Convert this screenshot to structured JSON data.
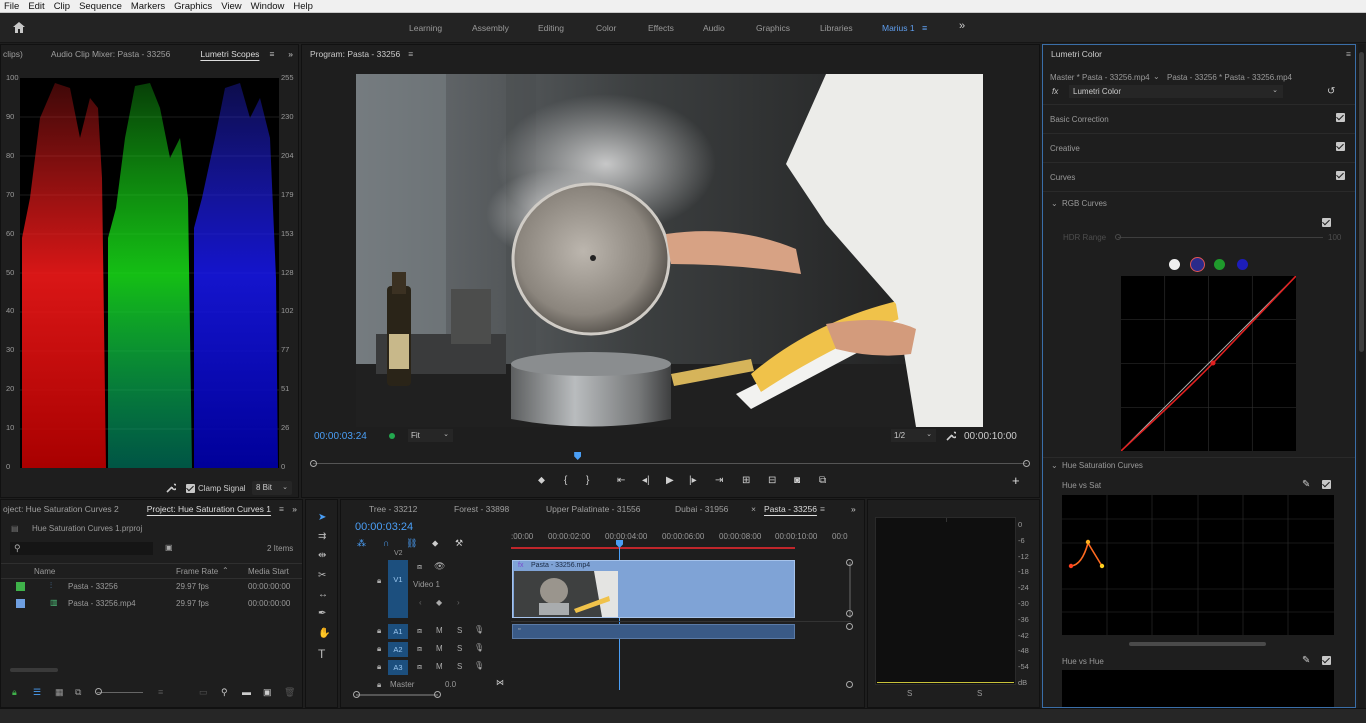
{
  "menubar": {
    "items": [
      "File",
      "Edit",
      "Clip",
      "Sequence",
      "Markers",
      "Graphics",
      "View",
      "Window",
      "Help"
    ]
  },
  "workspaces": {
    "items": [
      "Learning",
      "Assembly",
      "Editing",
      "Color",
      "Effects",
      "Audio",
      "Graphics",
      "Libraries"
    ],
    "active": "Marius 1",
    "overflow": "»"
  },
  "scopes": {
    "tabs": [
      "clips)",
      "Audio Clip Mixer: Pasta - 33256",
      "Lumetri Scopes"
    ],
    "left_axis": [
      "100",
      "90",
      "80",
      "70",
      "60",
      "50",
      "40",
      "30",
      "20",
      "10",
      "0"
    ],
    "right_axis": [
      "255",
      "230",
      "204",
      "179",
      "153",
      "128",
      "102",
      "77",
      "51",
      "26",
      "0"
    ],
    "clamp_label": "Clamp Signal",
    "bit_depth": "8 Bit"
  },
  "program": {
    "title": "Program: Pasta - 33256",
    "timecode": "00:00:03:24",
    "fit": "Fit",
    "resolution": "1/2",
    "duration": "00:00:10:00",
    "playhead_fraction": 0.37
  },
  "lumetri": {
    "title": "Lumetri Color",
    "master": "Master * Pasta - 33256.mp4",
    "clip": "Pasta - 33256 * Pasta - 33256.mp4",
    "effect": "Lumetri Color",
    "sections": [
      "Basic Correction",
      "Creative",
      "Curves"
    ],
    "rgb_curves": "RGB Curves",
    "hdr_range": "HDR Range",
    "hdr_value": "100",
    "hue_sat_curves": "Hue Saturation Curves",
    "hue_vs_sat": "Hue vs Sat",
    "hue_vs_hue": "Hue vs Hue"
  },
  "project": {
    "tabs": [
      "oject: Hue Saturation Curves 2",
      "Project: Hue Saturation Curves 1"
    ],
    "file": "Hue Saturation Curves 1.prproj",
    "count": "2 Items",
    "columns": [
      "Name",
      "Frame Rate",
      "Media Start"
    ],
    "rows": [
      {
        "name": "Pasta - 33256",
        "rate": "29.97 fps",
        "start": "00:00:00:00",
        "color": "#3fb24a"
      },
      {
        "name": "Pasta - 33256.mp4",
        "rate": "29.97 fps",
        "start": "00:00:00:00",
        "color": "#6f9fe0"
      }
    ]
  },
  "timeline": {
    "tabs": [
      "Tree - 33212",
      "Forest - 33898",
      "Upper Palatinate - 31556",
      "Dubai - 31956",
      "Pasta - 33256"
    ],
    "timecode": "00:00:03:24",
    "ruler": [
      ":00:00",
      "00:00:02:00",
      "00:00:04:00",
      "00:00:06:00",
      "00:00:08:00",
      "00:00:10:00",
      "00:0"
    ],
    "tracks": [
      "V2",
      "V1",
      "A1",
      "A2",
      "A3"
    ],
    "video1": "Video 1",
    "master": "Master",
    "master_val": "0.0",
    "clip_name": "Pasta - 33256.mp4",
    "m": "M",
    "s": "S"
  },
  "meter": {
    "scale": [
      "0",
      "-6",
      "-12",
      "-18",
      "-24",
      "-30",
      "-36",
      "-42",
      "-48",
      "-54",
      "dB"
    ],
    "solo": [
      "S",
      "S"
    ]
  }
}
